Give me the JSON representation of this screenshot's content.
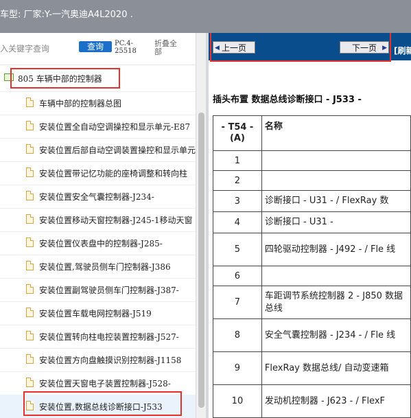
{
  "header": {
    "title": "车型:  厂家:Y-一汽奥迪A4L2020  ."
  },
  "search": {
    "placeholder": "入关键字查询",
    "button_label": "查询",
    "pc_label": "PC.4-25518",
    "fold_label": "折叠全部"
  },
  "tree": {
    "root_label": "805 车辆中部的控制器",
    "items": [
      "车辆中部的控制器总图",
      "安装位置全自动空调操控和显示单元-E87",
      "安装位置后部自动空调装置操控和显示单元",
      "安装位置带记忆功能的座椅调整和转向柱",
      "安装位置安全气囊控制器-J234-",
      "安装位置移动天窗控制器-J245-1移动天窗",
      "安装位置仪表盘中的控制器-J285-",
      "安装位置,驾驶员侧车门控制器-J386",
      "安装位置副驾驶员侧车门控制器-J387-",
      "安装位置车载电网控制器-J519",
      "安装位置转向柱电控装置控制器-J527-",
      "安装位置方向盘触摸识别控制器-J1158",
      "安装位置天窗电子装置控制器-J528-",
      "安装位置,数据总线诊断接口-J533"
    ]
  },
  "nav": {
    "prev_label": "上一页",
    "next_label": "下一页",
    "refresh_label": "[刷新"
  },
  "document": {
    "title": "插头布置 数据总线诊断接口 - J533  -",
    "table": {
      "col_pin": "- T54 - (A)",
      "col_name": "名称",
      "rows": [
        {
          "pin": "1",
          "name": ""
        },
        {
          "pin": "2",
          "name": ""
        },
        {
          "pin": "3",
          "name": "诊断接口 - U31  - / FlexRay 数"
        },
        {
          "pin": "4",
          "name": "诊断接口 - U31  -"
        },
        {
          "pin": "5",
          "name": "四轮驱动控制器 - J492  - / Fle 线"
        },
        {
          "pin": "6",
          "name": ""
        },
        {
          "pin": "7",
          "name": "车距调节系统控制器 2 - J850  数据总线"
        },
        {
          "pin": "8",
          "name": "安全气囊控制器 - J234  - / Fle 线"
        },
        {
          "pin": "9",
          "name": "FlexRay 数据总线/ 自动变速箱"
        },
        {
          "pin": "10",
          "name": "发动机控制器 - J623  - / FlexF"
        }
      ]
    }
  },
  "colors": {
    "topbar": "#8a8f98",
    "navbar": "#0a4d8c",
    "query_button": "#1c6fc8",
    "highlight": "#e5322d"
  }
}
